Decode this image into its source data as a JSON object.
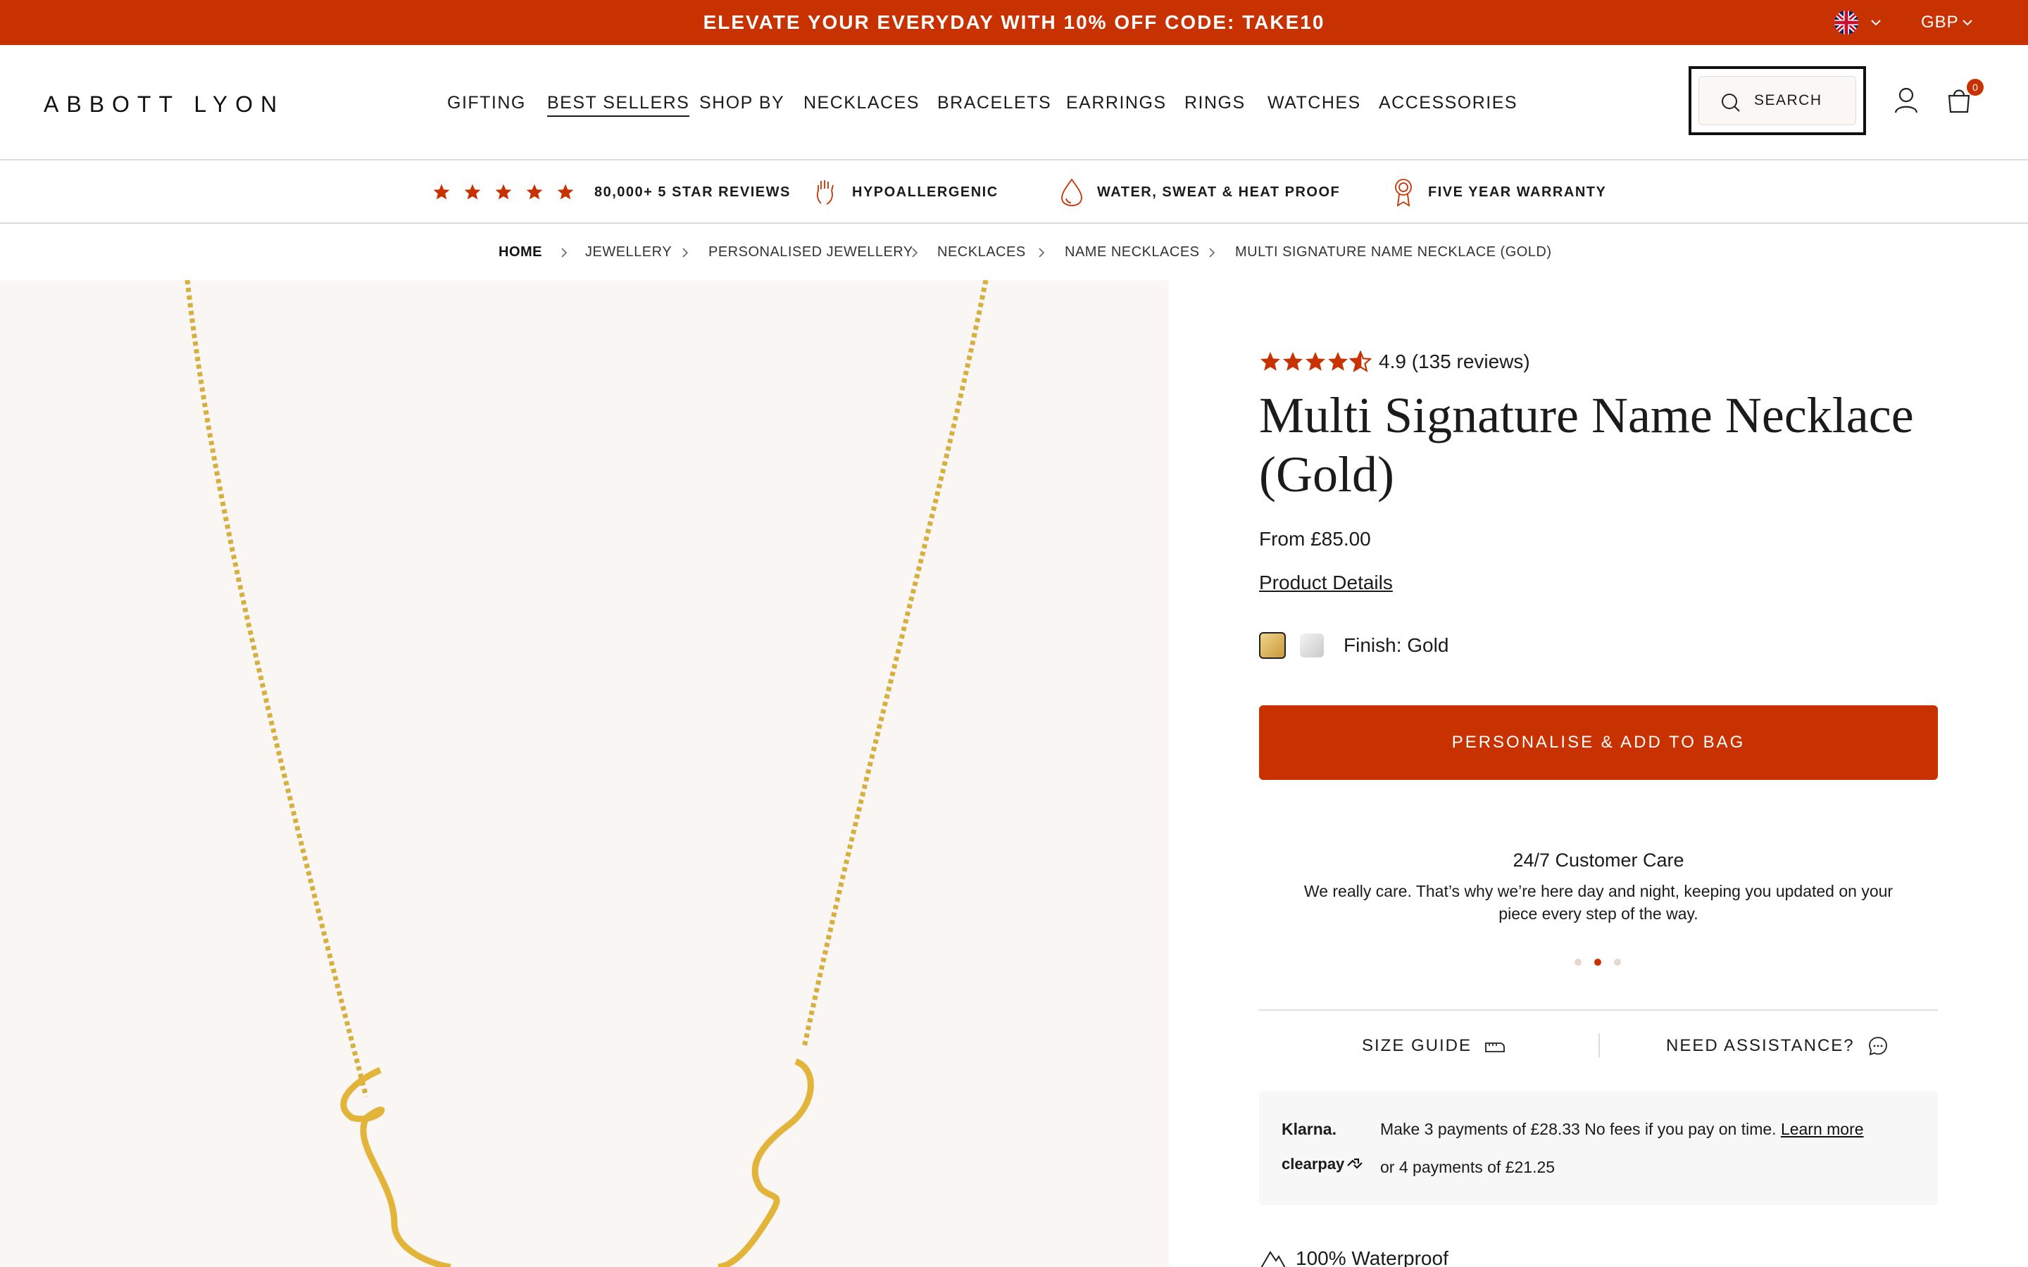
{
  "promo": {
    "text": "ELEVATE YOUR EVERYDAY WITH 10% OFF CODE: TAKE10",
    "currency": "GBP",
    "flag_icon": "uk-flag-icon"
  },
  "header": {
    "logo": "ABBOTT LYON",
    "nav": [
      "GIFTING",
      "BEST SELLERS",
      "SHOP BY",
      "NECKLACES",
      "BRACELETS",
      "EARRINGS",
      "RINGS",
      "WATCHES",
      "ACCESSORIES"
    ],
    "active_nav": "BEST SELLERS",
    "search_label": "SEARCH",
    "bag_count": "0"
  },
  "usp": [
    {
      "label": "80,000+ 5 STAR REVIEWS",
      "icon": "stars-icon"
    },
    {
      "label": "HYPOALLERGENIC",
      "icon": "hand-icon"
    },
    {
      "label": "WATER, SWEAT & HEAT PROOF",
      "icon": "water-drop-icon"
    },
    {
      "label": "FIVE YEAR WARRANTY",
      "icon": "award-icon"
    }
  ],
  "breadcrumb": [
    "HOME",
    "JEWELLERY",
    "PERSONALISED JEWELLERY",
    "NECKLACES",
    "NAME NECKLACES",
    "MULTI SIGNATURE NAME NECKLACE (GOLD)"
  ],
  "product": {
    "rating": "4.9 (135 reviews)",
    "rating_value": 4.9,
    "title": "Multi Signature Name Necklace (Gold)",
    "price": "From £85.00",
    "details_link": "Product Details",
    "finish_label": "Finish: Gold",
    "swatches": [
      "gold",
      "silver"
    ],
    "add_button": "PERSONALISE & ADD TO BAG"
  },
  "care": {
    "title": "24/7 Customer Care",
    "text": "We really care. That’s why we’re here day and night, keeping you updated on your piece every step of the way.",
    "active_slide": 2,
    "slides": 3
  },
  "links": {
    "size_guide": "SIZE GUIDE",
    "assistance": "NEED ASSISTANCE?"
  },
  "payment": {
    "klarna_brand": "Klarna.",
    "klarna_text": "Make 3 payments of £28.33 No fees if you pay on time.",
    "klarna_link": "Learn more",
    "clearpay_brand": "clearpay",
    "clearpay_text": "or 4 payments of £21.25"
  },
  "features": {
    "waterproof": "100% Waterproof"
  },
  "colors": {
    "accent": "#c83200"
  }
}
